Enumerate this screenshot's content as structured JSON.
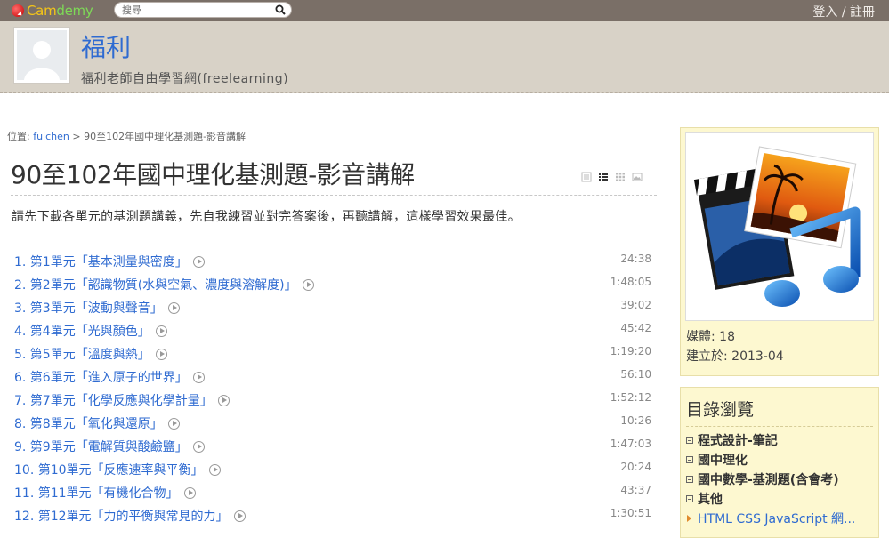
{
  "topbar": {
    "logo_text_a": "Cam",
    "logo_text_b": "demy",
    "search_placeholder": "搜尋",
    "login": "登入 / 註冊",
    "colors": {
      "bar": "#7a6f67",
      "logo_a": "#f5c518",
      "logo_b": "#7ed957"
    }
  },
  "header": {
    "title": "福利",
    "subtitle": "福利老師自由學習網(freelearning)",
    "colors": {
      "bg": "#d8d2c7",
      "title": "#2f6bd1"
    }
  },
  "breadcrumb": {
    "prefix": "位置: ",
    "user": "fuichen",
    "sep": " > ",
    "current": "90至102年國中理化基測題-影音講解"
  },
  "page": {
    "title": "90至102年國中理化基測題-影音講解",
    "intro": "請先下載各單元的基測題講義，先自我練習並對完答案後，再聽講解，這樣學習效果最佳。",
    "view_icons": [
      "list-detail-icon",
      "list-icon",
      "grid-icon",
      "image-icon"
    ]
  },
  "episodes": [
    {
      "label": "1. 第1單元「基本測量與密度」",
      "duration": "24:38"
    },
    {
      "label": "2. 第2單元「認識物質(水與空氣、濃度與溶解度)」",
      "duration": "1:48:05"
    },
    {
      "label": "3. 第3單元「波動與聲音」",
      "duration": "39:02"
    },
    {
      "label": "4. 第4單元「光與顏色」",
      "duration": "45:42"
    },
    {
      "label": "5. 第5單元「溫度與熱」",
      "duration": "1:19:20"
    },
    {
      "label": "6. 第6單元「進入原子的世界」",
      "duration": "56:10"
    },
    {
      "label": "7. 第7單元「化學反應與化學計量」",
      "duration": "1:52:12"
    },
    {
      "label": "8. 第8單元「氧化與還原」",
      "duration": "10:26"
    },
    {
      "label": "9. 第9單元「電解質與酸鹼鹽」",
      "duration": "1:47:03"
    },
    {
      "label": "10. 第10單元「反應速率與平衡」",
      "duration": "20:24"
    },
    {
      "label": "11. 第11單元「有機化合物」",
      "duration": "43:37"
    },
    {
      "label": "12. 第12單元「力的平衡與常見的力」",
      "duration": "1:30:51"
    }
  ],
  "sidebar": {
    "media_count": "媒體: 18",
    "created": "建立於: 2013-04",
    "dir_title": "目錄瀏覽",
    "dir_items": [
      {
        "label": "程式設計-筆記",
        "bold": true,
        "icon": "collapse-box-icon"
      },
      {
        "label": "國中理化",
        "bold": true,
        "icon": "collapse-box-icon"
      },
      {
        "label": "國中數學-基測題(含會考)",
        "bold": true,
        "icon": "collapse-box-icon"
      },
      {
        "label": "其他",
        "bold": true,
        "icon": "collapse-box-icon"
      },
      {
        "label": "HTML CSS JavaScript 網...",
        "bold": false,
        "icon": "triangle-bullet-icon"
      }
    ],
    "colors": {
      "bg": "#fdf8d0",
      "border": "#e8dfa9"
    }
  }
}
